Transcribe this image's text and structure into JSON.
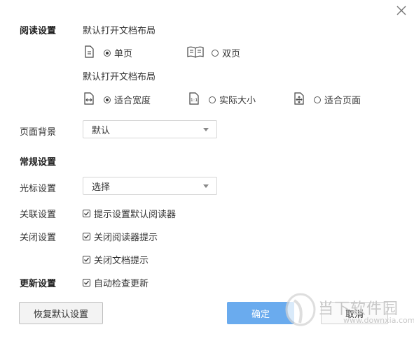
{
  "dialog": {
    "close_icon": "close-icon"
  },
  "reading": {
    "section_label": "阅读设置",
    "layout_label": "默认打开文档布局",
    "layout_options": [
      {
        "label": "单页",
        "icon": "single-page-icon",
        "selected": true
      },
      {
        "label": "双页",
        "icon": "double-page-icon",
        "selected": false
      }
    ],
    "zoom_label": "默认打开文档布局",
    "zoom_options": [
      {
        "label": "适合宽度",
        "icon": "fit-width-icon",
        "selected": true
      },
      {
        "label": "实际大小",
        "icon": "actual-size-icon",
        "selected": false
      },
      {
        "label": "适合页面",
        "icon": "fit-page-icon",
        "selected": false
      }
    ],
    "background_label": "页面背景",
    "background_value": "默认"
  },
  "general": {
    "section_label": "常规设置",
    "cursor_label": "光标设置",
    "cursor_value": "选择",
    "association_label": "关联设置",
    "association_option": "提示设置默认阅读器",
    "close_label": "关闭设置",
    "close_options": [
      "关闭阅读器提示",
      "关闭文档提示"
    ]
  },
  "update": {
    "section_label": "更新设置",
    "auto_check_label": "自动检查更新"
  },
  "footer": {
    "restore_label": "恢复默认设置",
    "confirm_label": "确定",
    "cancel_label": "取消"
  },
  "watermark": {
    "name": "当下软件园",
    "url": "www.downxia.com"
  }
}
